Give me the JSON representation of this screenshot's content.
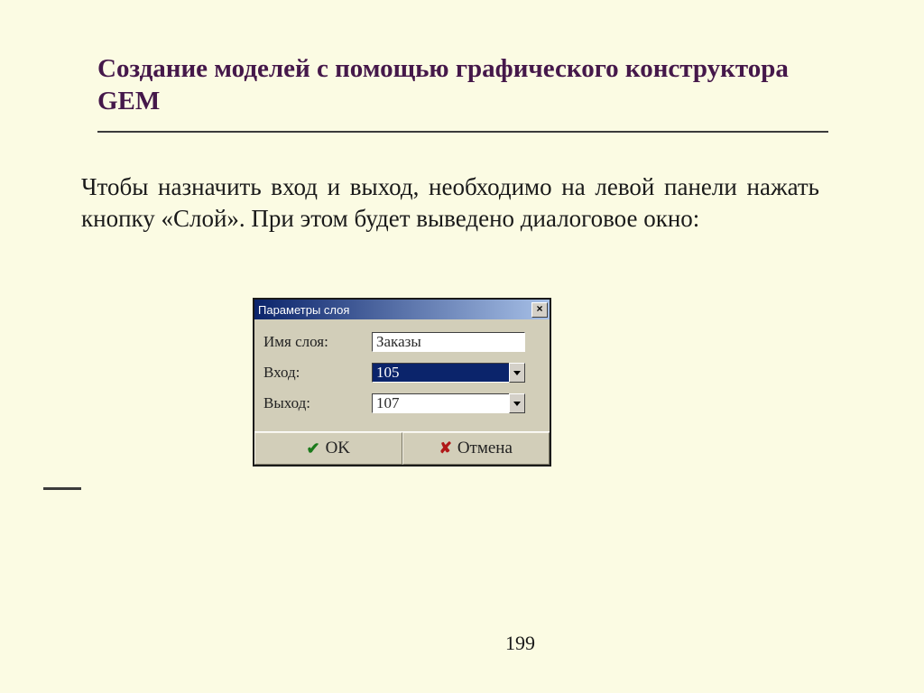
{
  "title": "Создание моделей с помощью графического конструктора GEM",
  "body": "Чтобы назначить вход и выход, необходимо на левой панели нажать кнопку «Слой». При этом будет выведено диалоговое окно:",
  "page_number": "199",
  "dialog": {
    "title": "Параметры слоя",
    "fields": {
      "name_label": "Имя слоя:",
      "name_value": "Заказы",
      "input_label": "Вход:",
      "input_value": "105",
      "output_label": "Выход:",
      "output_value": "107"
    },
    "buttons": {
      "ok": "OK",
      "cancel": "Отмена"
    }
  }
}
